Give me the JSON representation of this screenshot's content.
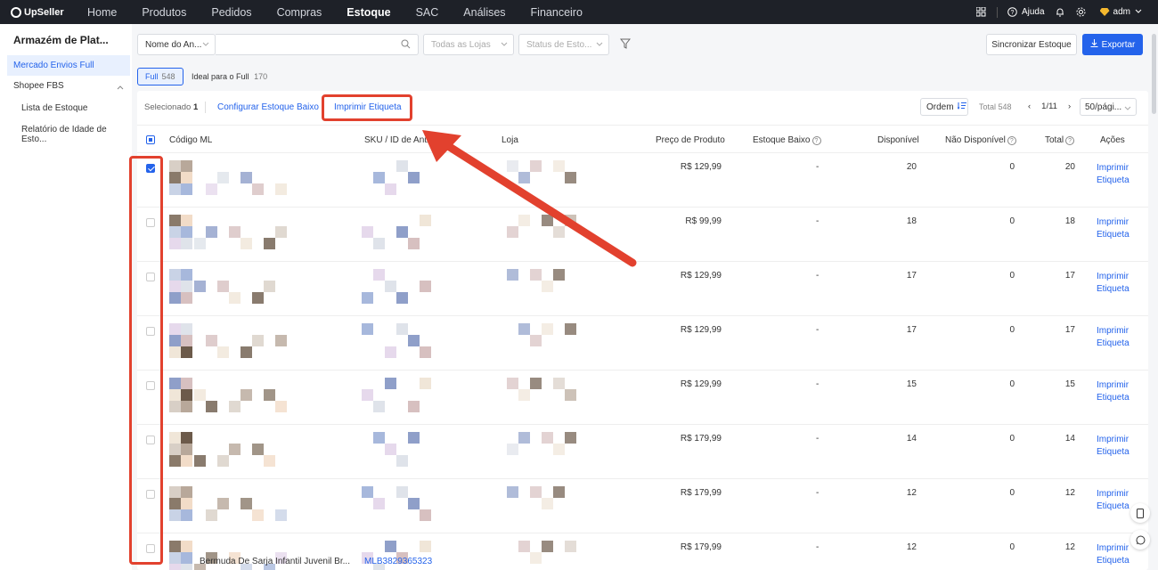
{
  "app": {
    "logo": "UpSeller"
  },
  "nav": [
    {
      "label": "Home",
      "active": false
    },
    {
      "label": "Produtos",
      "active": false
    },
    {
      "label": "Pedidos",
      "active": false
    },
    {
      "label": "Compras",
      "active": false
    },
    {
      "label": "Estoque",
      "active": true
    },
    {
      "label": "SAC",
      "active": false
    },
    {
      "label": "Análises",
      "active": false
    },
    {
      "label": "Financeiro",
      "active": false
    }
  ],
  "topright": {
    "help": "Ajuda",
    "user": "adm"
  },
  "sidebar": {
    "title": "Armazém de Plat...",
    "active_item": "Mercado Envios Full",
    "group": "Shopee FBS",
    "sub1": "Lista de Estoque",
    "sub2": "Relatório de Idade de Esto..."
  },
  "filters": {
    "field_select": "Nome do An...",
    "search_placeholder": "",
    "stores_placeholder": "Todas as Lojas",
    "status_placeholder": "Status de Esto...",
    "sync_label": "Sincronizar Estoque",
    "export_label": "Exportar"
  },
  "tabs": {
    "full_label": "Full",
    "full_count": "548",
    "ideal_label": "Ideal para o Full",
    "ideal_count": "170"
  },
  "toolbar": {
    "selected_label": "Selecionado",
    "selected_count": "1",
    "config_label": "Configurar Estoque Baixo",
    "print_label": "Imprimir Etiqueta",
    "order_label": "Ordem",
    "total_label": "Total 548",
    "page": "1/11",
    "per_page": "50/pági..."
  },
  "columns": {
    "code": "Código ML",
    "sku": "SKU / ID de Anúncio",
    "store": "Loja",
    "price": "Preço de Produto",
    "low": "Estoque Baixo",
    "available": "Disponível",
    "unavailable": "Não Disponível",
    "total": "Total",
    "actions": "Ações"
  },
  "rows": [
    {
      "price": "R$ 129,99",
      "low": "-",
      "available": "20",
      "unavailable": "0",
      "total": "20",
      "action1": "Imprimir",
      "action2": "Etiqueta",
      "checked": true
    },
    {
      "price": "R$ 99,99",
      "low": "-",
      "available": "18",
      "unavailable": "0",
      "total": "18",
      "action1": "Imprimir",
      "action2": "Etiqueta",
      "checked": false
    },
    {
      "price": "R$ 129,99",
      "low": "-",
      "available": "17",
      "unavailable": "0",
      "total": "17",
      "action1": "Imprimir",
      "action2": "Etiqueta",
      "checked": false
    },
    {
      "price": "R$ 129,99",
      "low": "-",
      "available": "17",
      "unavailable": "0",
      "total": "17",
      "action1": "Imprimir",
      "action2": "Etiqueta",
      "checked": false
    },
    {
      "price": "R$ 129,99",
      "low": "-",
      "available": "15",
      "unavailable": "0",
      "total": "15",
      "action1": "Imprimir",
      "action2": "Etiqueta",
      "checked": false
    },
    {
      "price": "R$ 179,99",
      "low": "-",
      "available": "14",
      "unavailable": "0",
      "total": "14",
      "action1": "Imprimir",
      "action2": "Etiqueta",
      "checked": false
    },
    {
      "price": "R$ 179,99",
      "low": "-",
      "available": "12",
      "unavailable": "0",
      "total": "12",
      "action1": "Imprimir",
      "action2": "Etiqueta",
      "checked": false
    },
    {
      "price": "R$ 179,99",
      "low": "-",
      "available": "12",
      "unavailable": "0",
      "total": "12",
      "action1": "Imprimir",
      "action2": "Etiqueta",
      "checked": false
    }
  ],
  "partial_row": {
    "title": "Bermuda De Sarja Infantil Juvenil Br...",
    "mlb": "MLB3829365323"
  },
  "colors": {
    "accent": "#2463eb",
    "annotation": "#e2412e",
    "topbar": "#1e2128"
  }
}
